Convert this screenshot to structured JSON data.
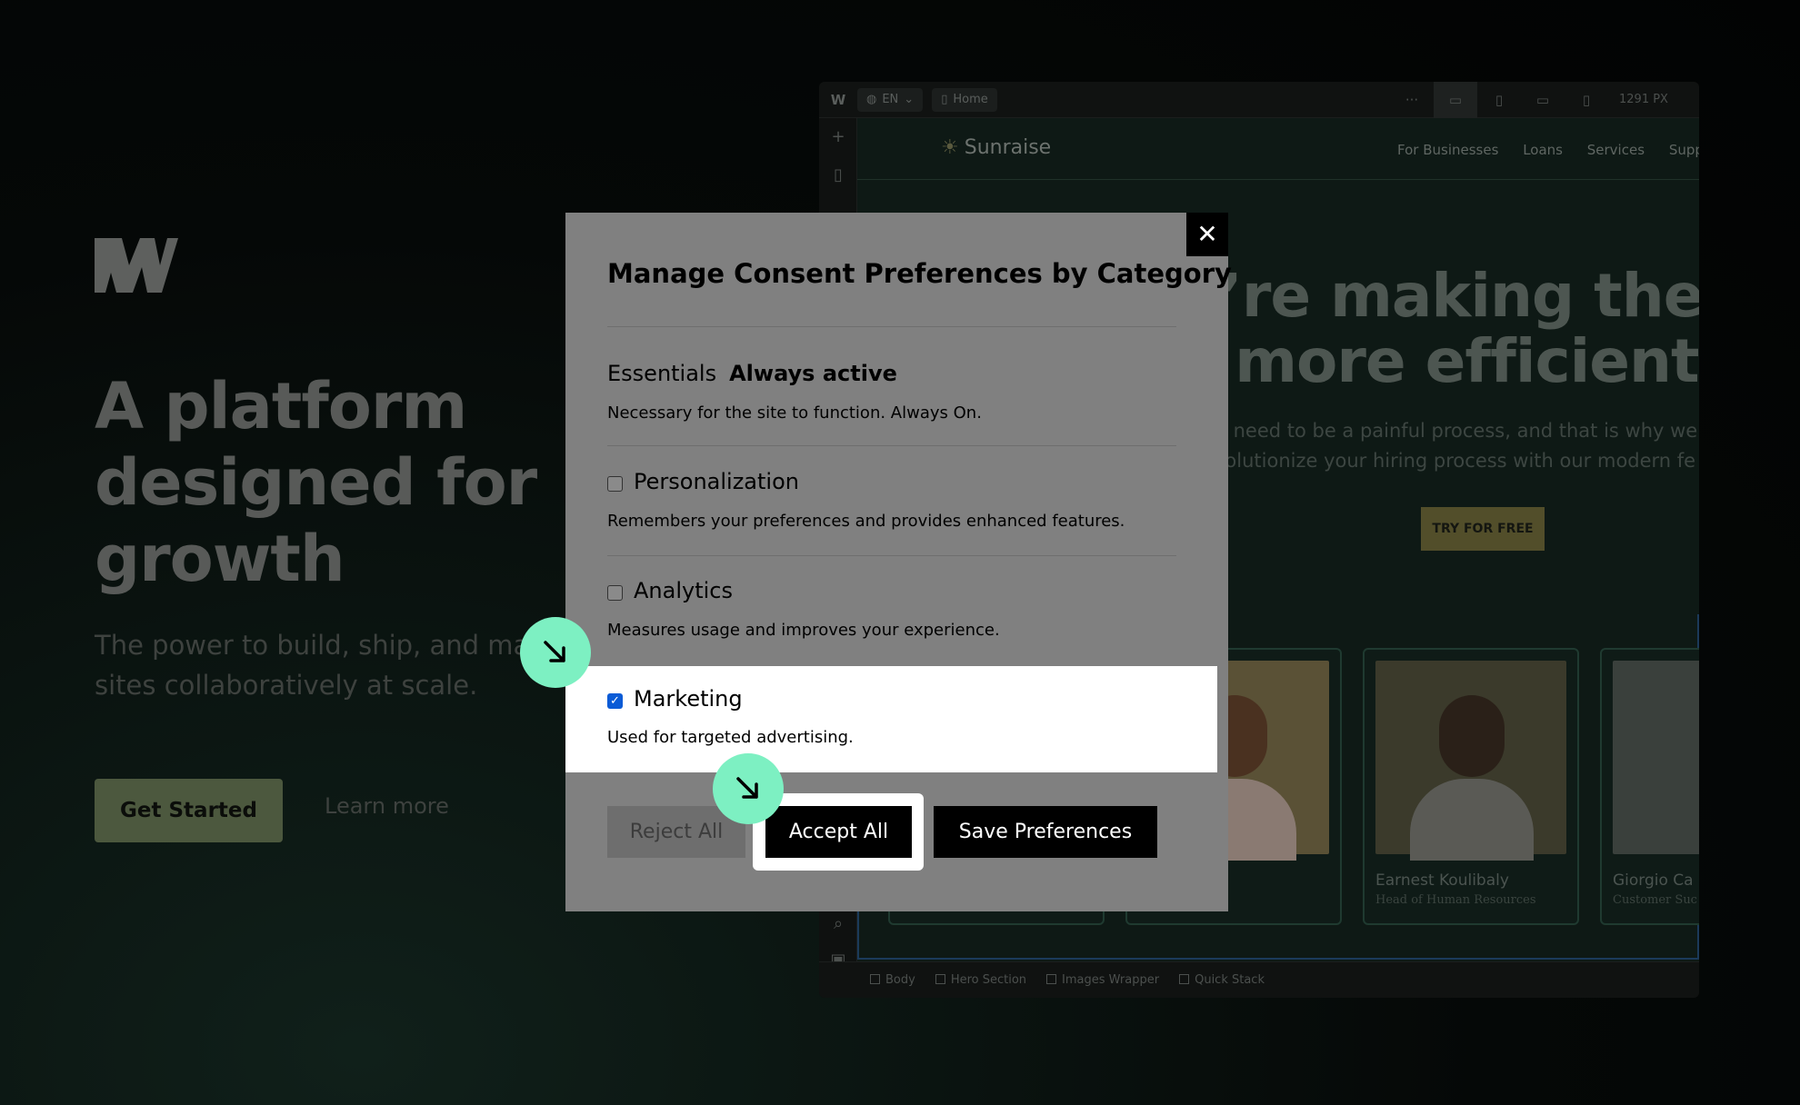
{
  "hero": {
    "title_lines": [
      "A platform",
      "designed for",
      "growth"
    ],
    "subtitle_lines": [
      "The power to build, ship, and ma",
      "sites collaboratively at scale."
    ],
    "primary_button": "Get Started",
    "secondary_link": "Learn more"
  },
  "designer": {
    "topbar": {
      "locale": "EN",
      "page": "Home",
      "more": "···",
      "width_readout": "1291 PX"
    },
    "site": {
      "brand": "Sunraise",
      "nav": [
        "For Businesses",
        "Loans",
        "Services",
        "Supp"
      ],
      "headline_lines": [
        "e’re making the hi",
        "s more efficient th"
      ],
      "paragraph_lines": [
        "’t need to be a painful process, and that is why we",
        "volutionize your hiring process with our modern fe"
      ],
      "cta": "TRY FOR FREE",
      "cards": [
        {
          "name": "",
          "role": ""
        },
        {
          "name": "",
          "role": ""
        },
        {
          "name": "Earnest Koulibaly",
          "role": "Head of Human Resources"
        },
        {
          "name": "Giorgio Ca",
          "role": "Customer Suc"
        }
      ]
    },
    "breadcrumbs": [
      "Body",
      "Hero Section",
      "Images Wrapper",
      "Quick Stack"
    ]
  },
  "modal": {
    "close": "✕",
    "title": "Manage Consent Preferences by Category",
    "essentials": {
      "label": "Essentials",
      "status": "Always active",
      "description": "Necessary for the site to function. Always On."
    },
    "personalization": {
      "label": "Personalization",
      "checked": false,
      "description": "Remembers your preferences and provides enhanced features."
    },
    "analytics": {
      "label": "Analytics",
      "checked": false,
      "description": "Measures usage and improves your experience."
    },
    "marketing": {
      "label": "Marketing",
      "checked": true,
      "check_glyph": "✓",
      "description": "Used for targeted advertising."
    },
    "buttons": {
      "reject": "Reject All",
      "accept": "Accept All",
      "save": "Save Preferences"
    }
  },
  "colors": {
    "accent_cursor": "#7df0c2",
    "checkbox_checked": "#0a5bd6"
  }
}
